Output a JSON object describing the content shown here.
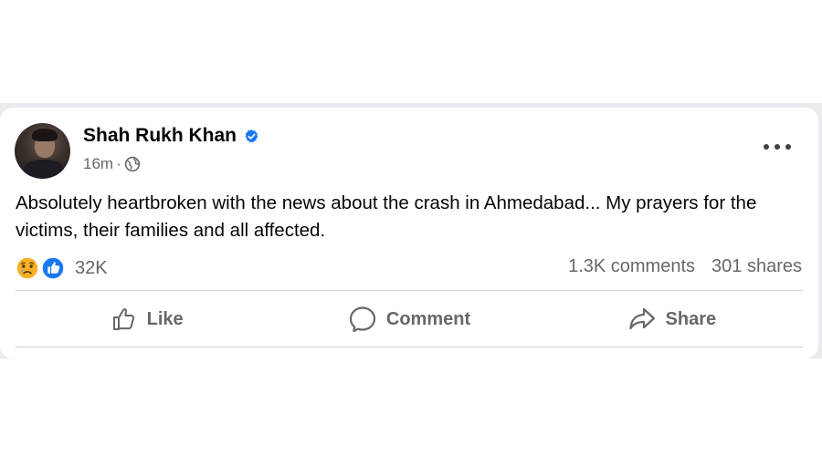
{
  "post": {
    "author": "Shah Rukh Khan",
    "verified": true,
    "timestamp": "16m",
    "meta_separator": "·",
    "audience_icon": "globe-icon",
    "text": "Absolutely heartbroken with the news about the crash in Ahmedabad... My prayers for the victims, their families and all affected."
  },
  "reactions": {
    "icons": [
      "sad-reaction-icon",
      "like-reaction-icon"
    ],
    "count": "32K"
  },
  "stats": {
    "comments": "1.3K comments",
    "shares": "301 shares"
  },
  "actions": {
    "like": "Like",
    "comment": "Comment",
    "share": "Share"
  },
  "colors": {
    "brand_blue": "#1877f2",
    "secondary_text": "#65676b",
    "primary_text": "#050505",
    "divider": "#ced0d4",
    "sad_yellow": "#f7b125"
  }
}
